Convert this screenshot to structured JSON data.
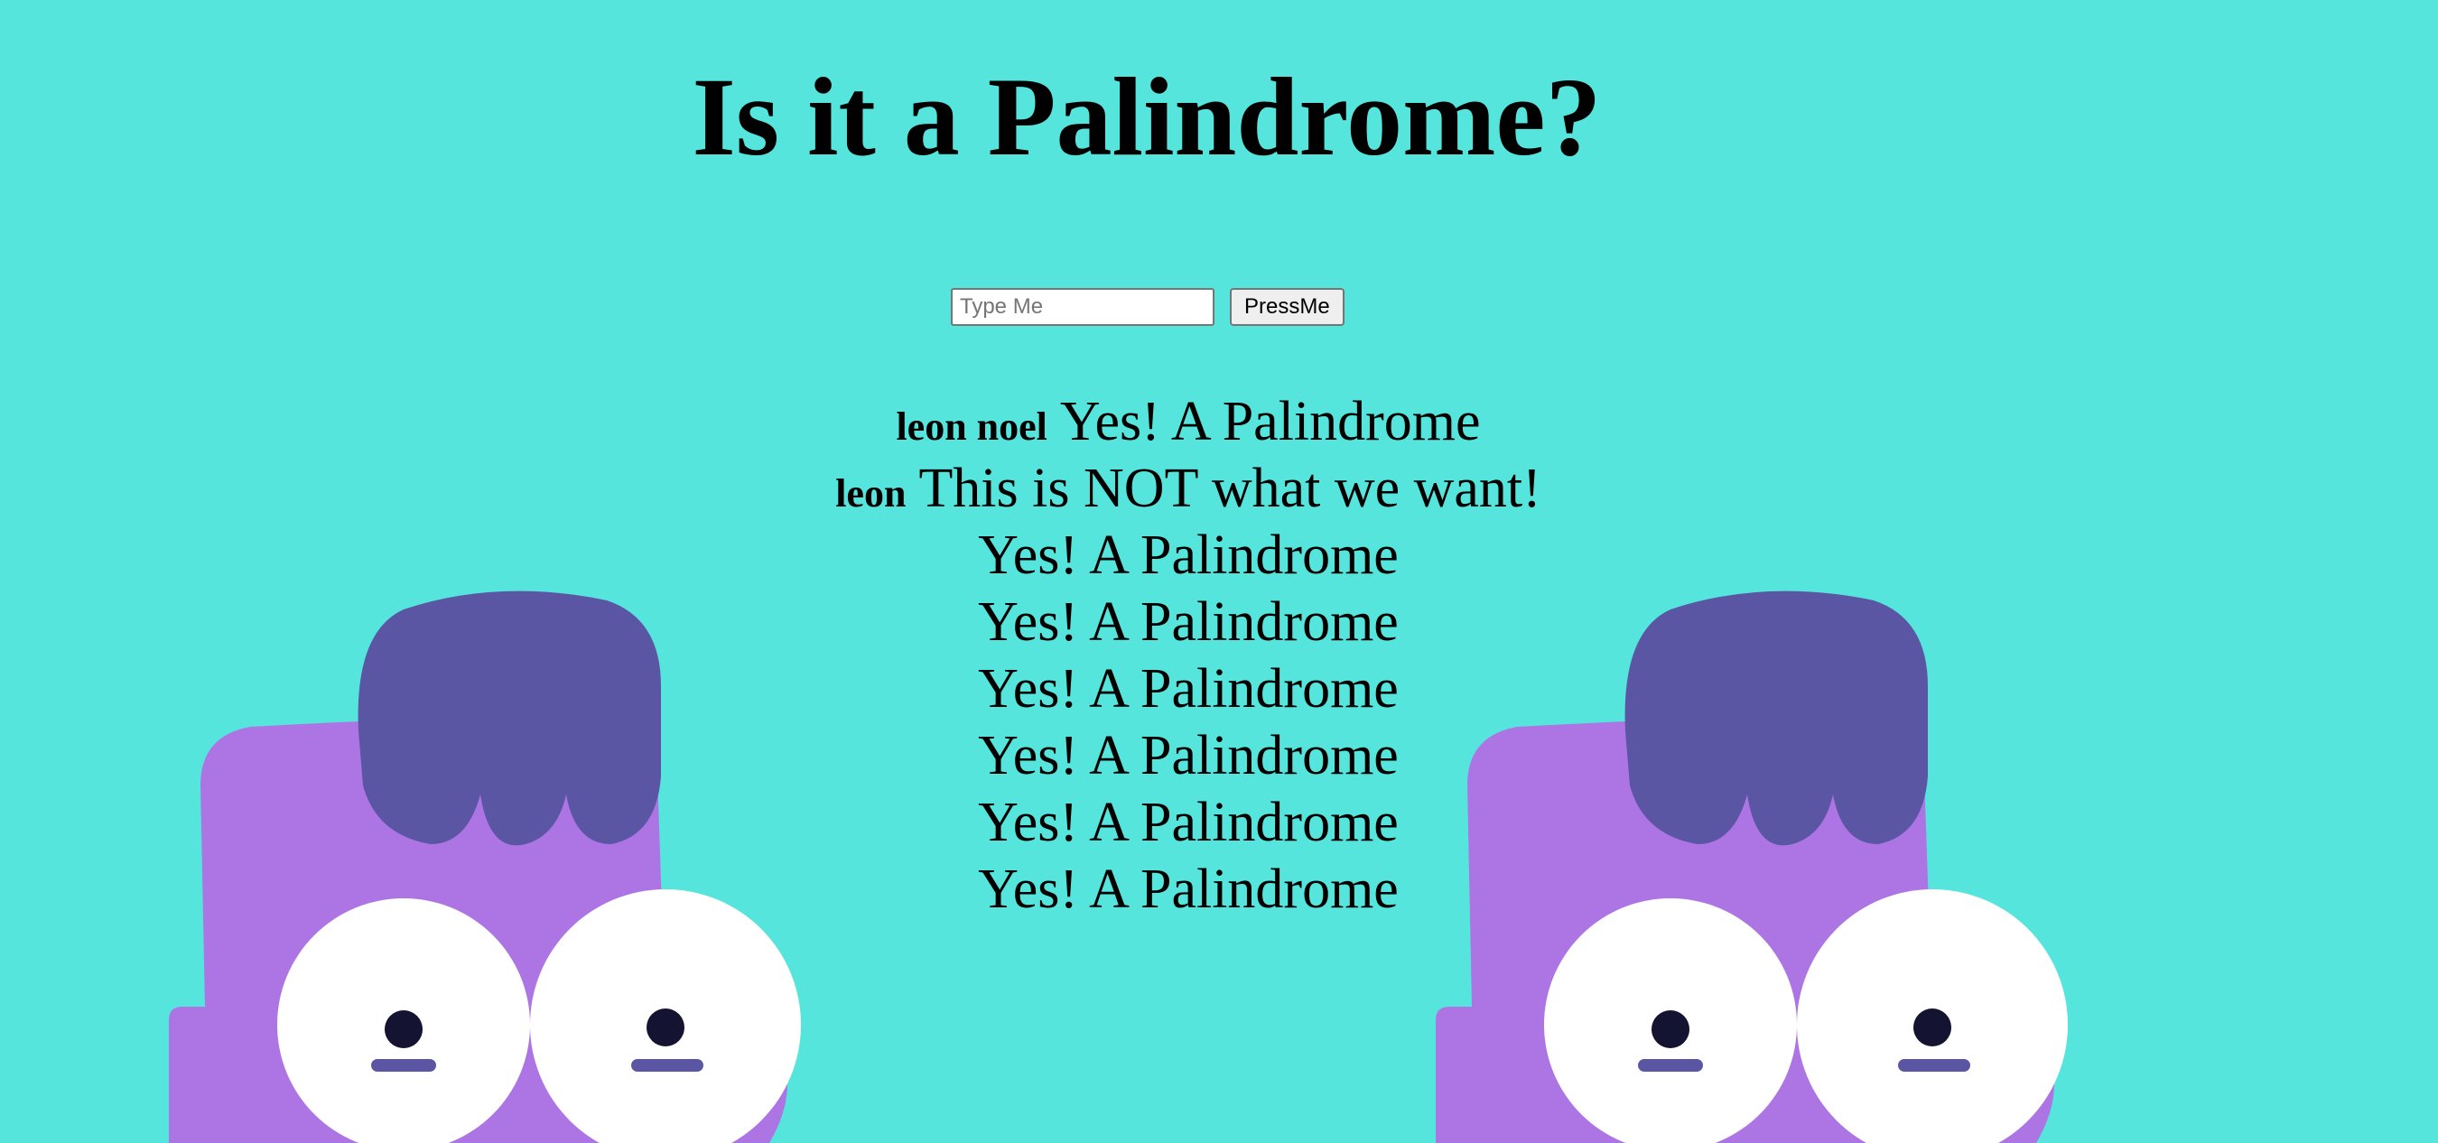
{
  "page": {
    "title": "Is it a Palindrome?",
    "background_color": "#56E5DD"
  },
  "form": {
    "input_value": "",
    "input_placeholder": "Type Me",
    "button_label": "PressMe"
  },
  "results": [
    {
      "word": "leon noel",
      "message": "Yes! A Palindrome"
    },
    {
      "word": "leon",
      "message": "This is NOT what we want!"
    },
    {
      "word": "",
      "message": "Yes! A Palindrome"
    },
    {
      "word": "",
      "message": "Yes! A Palindrome"
    },
    {
      "word": "",
      "message": "Yes! A Palindrome"
    },
    {
      "word": "",
      "message": "Yes! A Palindrome"
    },
    {
      "word": "",
      "message": "Yes! A Palindrome"
    },
    {
      "word": "",
      "message": "Yes! A Palindrome"
    }
  ],
  "background_art": {
    "subject": "purple-blob-character",
    "body_color": "#AD75E3",
    "hair_color": "#5B56A3",
    "eye_color": "#FFFFFF",
    "pupil_color": "#141432"
  }
}
